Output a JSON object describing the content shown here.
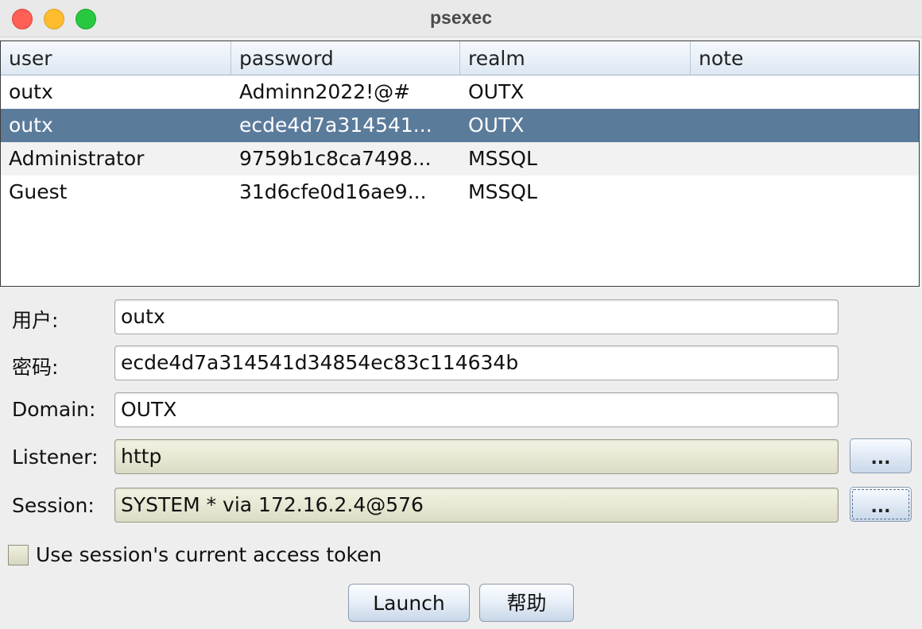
{
  "window": {
    "title": "psexec"
  },
  "table": {
    "columns": [
      "user",
      "password",
      "realm",
      "note"
    ],
    "rows": [
      {
        "user": "outx",
        "password": "Adminn2022!@#",
        "realm": "OUTX",
        "note": ""
      },
      {
        "user": "outx",
        "password": "ecde4d7a314541...",
        "realm": "OUTX",
        "note": ""
      },
      {
        "user": "Administrator",
        "password": "9759b1c8ca7498...",
        "realm": "MSSQL",
        "note": ""
      },
      {
        "user": "Guest",
        "password": "31d6cfe0d16ae9...",
        "realm": "MSSQL",
        "note": ""
      }
    ],
    "selected_row": 2
  },
  "form": {
    "user_label": "用户:",
    "user_value": "outx",
    "password_label": "密码:",
    "password_value": "ecde4d7a314541d34854ec83c114634b",
    "domain_label": "Domain:",
    "domain_value": "OUTX",
    "listener_label": "Listener:",
    "listener_value": "http",
    "listener_browse": "...",
    "session_label": "Session:",
    "session_value": "SYSTEM * via  172.16.2.4@576",
    "session_browse": "...",
    "token_checkbox_label": "Use session's current access token",
    "token_checked": false
  },
  "buttons": {
    "launch": "Launch",
    "help": "帮助"
  }
}
